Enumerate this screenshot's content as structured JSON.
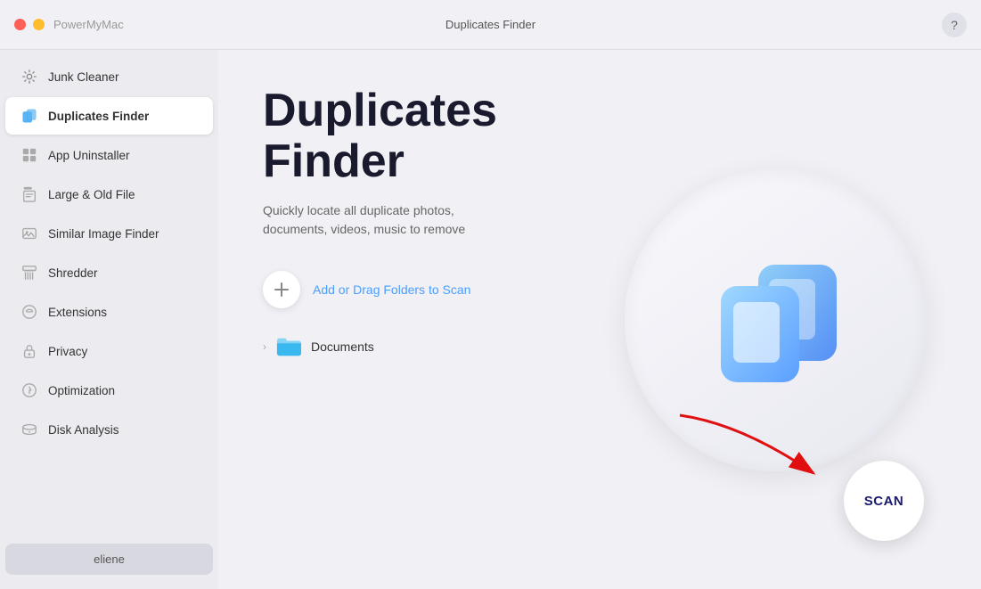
{
  "app": {
    "name": "PowerMyMac",
    "title": "Duplicates Finder",
    "help_label": "?"
  },
  "sidebar": {
    "items": [
      {
        "id": "junk-cleaner",
        "label": "Junk Cleaner",
        "icon": "gear-icon",
        "active": false
      },
      {
        "id": "duplicates-finder",
        "label": "Duplicates Finder",
        "icon": "duplicate-icon",
        "active": true
      },
      {
        "id": "app-uninstaller",
        "label": "App Uninstaller",
        "icon": "uninstall-icon",
        "active": false
      },
      {
        "id": "large-old-file",
        "label": "Large & Old File",
        "icon": "file-icon",
        "active": false
      },
      {
        "id": "similar-image-finder",
        "label": "Similar Image Finder",
        "icon": "image-icon",
        "active": false
      },
      {
        "id": "shredder",
        "label": "Shredder",
        "icon": "shredder-icon",
        "active": false
      },
      {
        "id": "extensions",
        "label": "Extensions",
        "icon": "extension-icon",
        "active": false
      },
      {
        "id": "privacy",
        "label": "Privacy",
        "icon": "privacy-icon",
        "active": false
      },
      {
        "id": "optimization",
        "label": "Optimization",
        "icon": "optimization-icon",
        "active": false
      },
      {
        "id": "disk-analysis",
        "label": "Disk Analysis",
        "icon": "disk-icon",
        "active": false
      }
    ],
    "user": "eliene"
  },
  "main": {
    "title_line1": "Duplicates",
    "title_line2": "Finder",
    "subtitle": "Quickly locate all duplicate photos,\ndocuments, videos, music to remove",
    "add_folder_label": "Add or Drag Folders to Scan",
    "folder_item": {
      "label": "Documents",
      "chevron": "›"
    },
    "scan_label": "SCAN"
  },
  "colors": {
    "accent_blue": "#4a9eff",
    "title_dark": "#1a1a2e",
    "scan_text": "#1a1a6e",
    "arrow_red": "#e01010"
  }
}
